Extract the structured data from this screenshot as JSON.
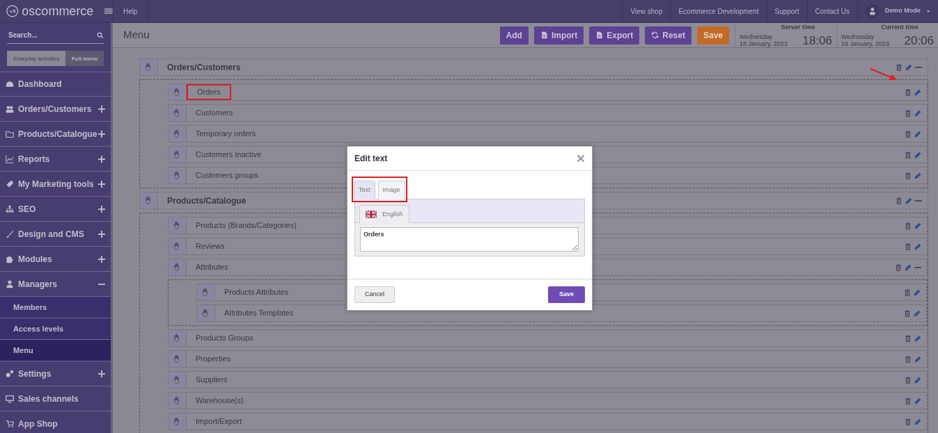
{
  "topbar": {
    "logo": "oscommerce",
    "help": "Help",
    "links": [
      "View shop",
      "Ecommerce Development",
      "Support",
      "Contact Us"
    ],
    "user": "Demo Mode"
  },
  "sidebar": {
    "search": {
      "placeholder": "Search..."
    },
    "modes": [
      {
        "label": "Everyday activities",
        "selected": false
      },
      {
        "label": "Full menu",
        "selected": true
      }
    ],
    "items": [
      {
        "label": "Dashboard"
      },
      {
        "label": "Orders/Customers",
        "expanded": false
      },
      {
        "label": "Products/Catalogue",
        "expanded": false
      },
      {
        "label": "Reports",
        "expanded": false
      },
      {
        "label": "My Marketing tools",
        "expanded": false
      },
      {
        "label": "SEO",
        "expanded": false
      },
      {
        "label": "Design and CMS",
        "expanded": false
      },
      {
        "label": "Modules",
        "expanded": false
      },
      {
        "label": "Managers",
        "expanded": true,
        "children": [
          {
            "label": "Members",
            "selected": false
          },
          {
            "label": "Access levels",
            "selected": false
          },
          {
            "label": "Menu",
            "selected": true
          }
        ]
      },
      {
        "label": "Settings",
        "expanded": false
      },
      {
        "label": "Sales channels"
      },
      {
        "label": "App Shop"
      }
    ]
  },
  "header": {
    "title": "Menu",
    "buttons": [
      {
        "label": "Add",
        "kind": "plain"
      },
      {
        "label": "Import",
        "kind": "file"
      },
      {
        "label": "Export",
        "kind": "file"
      },
      {
        "label": "Reset",
        "kind": "reset"
      },
      {
        "label": "Save",
        "kind": "save"
      }
    ],
    "clocks": [
      {
        "title": "Server time",
        "day": "Wednesday",
        "date": "18 January, 2023",
        "time": "18:06"
      },
      {
        "title": "Current time",
        "day": "Wednesday",
        "date": "18 January, 2023",
        "time": "20:06"
      }
    ]
  },
  "tree": [
    {
      "label": "Orders/Customers",
      "expanded": true,
      "children": [
        {
          "label": "Orders",
          "highlighted": true,
          "pointed": true
        },
        {
          "label": "Customers"
        },
        {
          "label": "Temporary orders"
        },
        {
          "label": "Customers Inactive"
        },
        {
          "label": "Customers groups"
        }
      ]
    },
    {
      "label": "Products/Catalogue",
      "expanded": true,
      "children": [
        {
          "label": "Products (Brands/Categories)"
        },
        {
          "label": "Reviews"
        },
        {
          "label": "Attributes",
          "expanded": true,
          "children": [
            {
              "label": "Products Attributes"
            },
            {
              "label": "Attributes Templates"
            }
          ]
        },
        {
          "label": "Products Groups"
        },
        {
          "label": "Properties"
        },
        {
          "label": "Suppliers"
        },
        {
          "label": "Warehouse(s)"
        },
        {
          "label": "Import/Export"
        }
      ]
    }
  ],
  "modal": {
    "title": "Edit text",
    "tabs_highlighted": true,
    "tabs": [
      {
        "label": "Text",
        "selected": true
      },
      {
        "label": "Image",
        "selected": false
      }
    ],
    "languages": [
      {
        "label": "English"
      }
    ],
    "value": "Orders",
    "cancel": "Cancel",
    "save": "Save"
  }
}
